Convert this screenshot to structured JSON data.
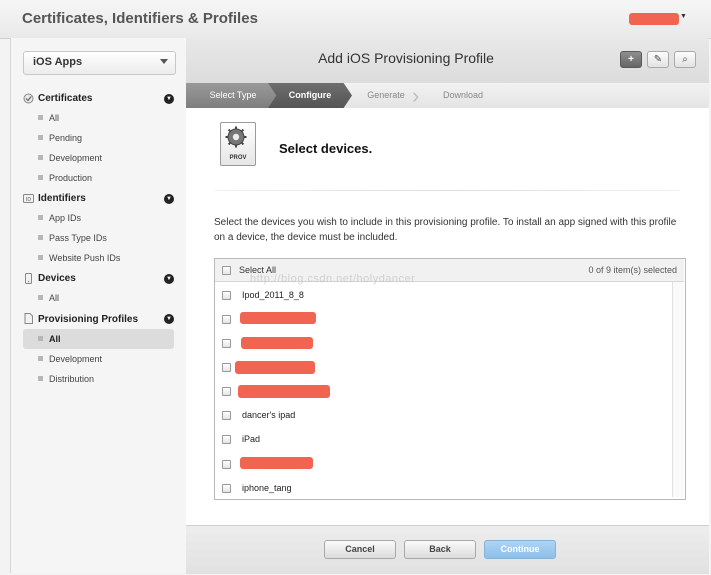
{
  "app": {
    "title": "Certificates, Identifiers & Profiles"
  },
  "sidebar": {
    "platform_selector": "iOS Apps",
    "sections": [
      {
        "title": "Certificates",
        "items": [
          "All",
          "Pending",
          "Development",
          "Production"
        ]
      },
      {
        "title": "Identifiers",
        "items": [
          "App IDs",
          "Pass Type IDs",
          "Website Push IDs"
        ]
      },
      {
        "title": "Devices",
        "items": [
          "All"
        ]
      },
      {
        "title": "Provisioning Profiles",
        "items": [
          "All",
          "Development",
          "Distribution"
        ],
        "active_item": "All"
      }
    ]
  },
  "header": {
    "title": "Add iOS Provisioning Profile",
    "buttons": {
      "add": "+",
      "edit": "✎",
      "search": "⌕"
    }
  },
  "steps": [
    "Select Type",
    "Configure",
    "Generate",
    "Download"
  ],
  "current_step": "Configure",
  "prov_icon_label": "PROV",
  "main": {
    "heading": "Select devices.",
    "instructions": "Select the devices you wish to include in this provisioning profile. To install an app signed with this profile on a device, the device must be included."
  },
  "device_list": {
    "select_all_label": "Select All",
    "selection_count": "0 of 9 item(s) selected",
    "watermark": "http://blog.csdn.net/holydancer",
    "devices": [
      "Ipod_2011_8_8",
      "",
      "",
      "",
      "",
      "dancer's ipad",
      "iPad",
      "",
      "iphone_tang"
    ]
  },
  "footer": {
    "cancel": "Cancel",
    "back": "Back",
    "continue": "Continue"
  },
  "colors": {
    "redaction": "#f26452",
    "continue_button": "#8dbfea"
  }
}
